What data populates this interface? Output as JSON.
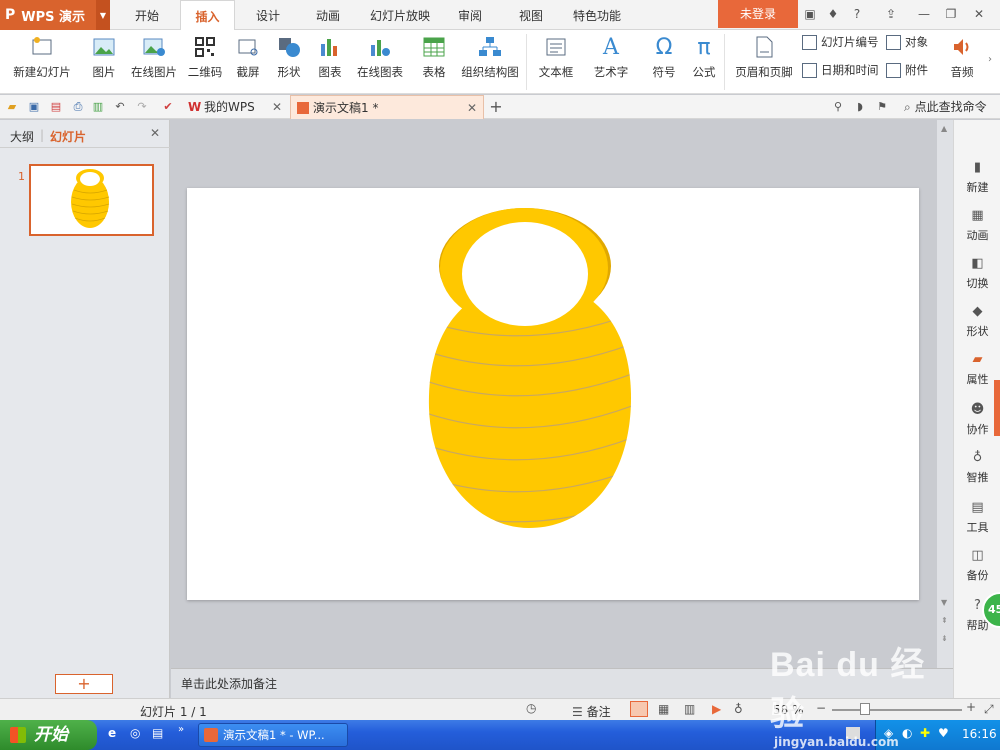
{
  "app": {
    "logo": "P",
    "name": "WPS 演示"
  },
  "menu_tabs": [
    "开始",
    "插入",
    "设计",
    "动画",
    "幻灯片放映",
    "审阅",
    "视图",
    "特色功能"
  ],
  "active_tab": "插入",
  "login_label": "未登录",
  "help_label": "?",
  "ribbon": {
    "large": [
      "新建幻灯片",
      "图片",
      "在线图片",
      "二维码",
      "截屏",
      "形状",
      "图表",
      "在线图表",
      "表格",
      "组织结构图",
      "文本框",
      "艺术字",
      "符号",
      "公式",
      "页眉和页脚",
      "音频"
    ],
    "small": [
      "幻灯片编号",
      "对象",
      "日期和时间",
      "附件"
    ]
  },
  "doc_tabs": {
    "mywps": "我的WPS",
    "doc": "演示文稿1 *"
  },
  "find_command": "点此查找命令",
  "left_pane": {
    "outline": "大纲",
    "slides": "幻灯片",
    "thumb_number": "1"
  },
  "notes_placeholder": "单击此处添加备注",
  "right_panel": [
    "新建",
    "动画",
    "切换",
    "形状",
    "属性",
    "协作",
    "智推",
    "工具",
    "备份",
    "帮助"
  ],
  "status": {
    "slide_counter": "幻灯片 1 / 1",
    "notes": "备注",
    "zoom": "58 %"
  },
  "badge": "45",
  "taskbar": {
    "start": "开始",
    "task": "演示文稿1 * - WP...",
    "clock": "16:16"
  },
  "watermark": {
    "brand": "Bai du 经验",
    "url": "jingyan.baidu.com"
  },
  "colors": {
    "accent": "#d9632d",
    "vase": "#ffc800",
    "vase_stripe": "#d7a600"
  }
}
